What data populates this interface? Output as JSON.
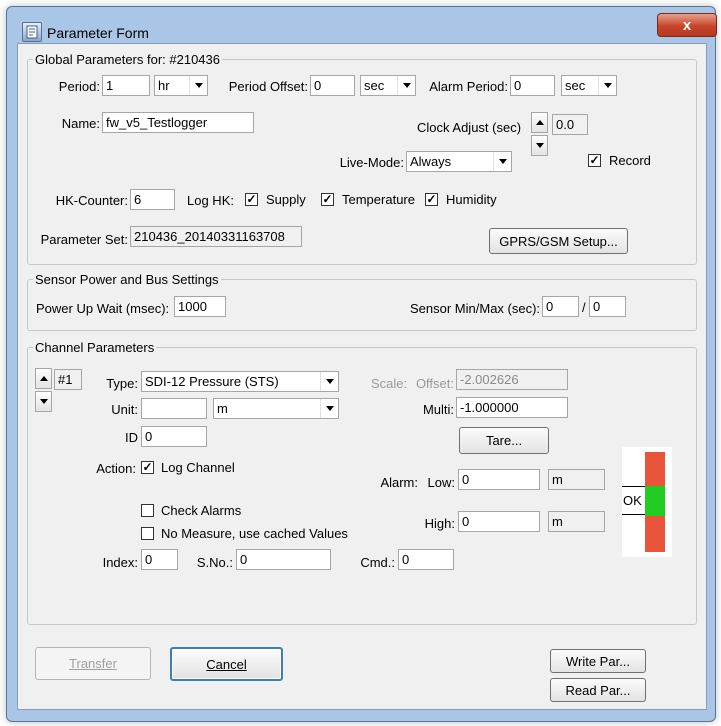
{
  "window": {
    "title": "Parameter Form",
    "close_label": "x"
  },
  "global": {
    "group_title": "Global Parameters for: #210436",
    "period": {
      "label": "Period:",
      "value": "1",
      "unit": "hr"
    },
    "period_offset": {
      "label": "Period Offset:",
      "value": "0",
      "unit": "sec"
    },
    "alarm_period": {
      "label": "Alarm Period:",
      "value": "0",
      "unit": "sec"
    },
    "name": {
      "label": "Name:",
      "value": "fw_v5_Testlogger"
    },
    "clock_adjust": {
      "label": "Clock Adjust (sec)",
      "value": "0.0"
    },
    "live_mode": {
      "label": "Live-Mode:",
      "value": "Always"
    },
    "record": {
      "label": "Record",
      "checked": true
    },
    "hk_counter": {
      "label": "HK-Counter:",
      "value": "6"
    },
    "log_hk": {
      "label": "Log HK:",
      "supply": {
        "label": "Supply",
        "checked": true
      },
      "temperature": {
        "label": "Temperature",
        "checked": true
      },
      "humidity": {
        "label": "Humidity",
        "checked": true
      }
    },
    "parameter_set": {
      "label": "Parameter Set:",
      "value": "210436_20140331163708"
    },
    "gprs_button": "GPRS/GSM Setup..."
  },
  "sensor_power": {
    "group_title": "Sensor Power and Bus Settings",
    "power_up_wait": {
      "label": "Power Up Wait  (msec):",
      "value": "1000"
    },
    "sensor_minmax": {
      "label": "Sensor Min/Max (sec):",
      "min": "0",
      "separator": "/",
      "max": "0"
    }
  },
  "channel": {
    "group_title": "Channel Parameters",
    "number": "#1",
    "type": {
      "label": "Type:",
      "value": "SDI-12 Pressure (STS)"
    },
    "scale": {
      "label": "Scale:"
    },
    "offset": {
      "label": "Offset:",
      "value": "-2.002626"
    },
    "unit": {
      "label": "Unit:",
      "custom": "",
      "value": "m"
    },
    "multi": {
      "label": "Multi:",
      "value": "-1.000000"
    },
    "id": {
      "label": "ID",
      "value": "0"
    },
    "tare_button": "Tare...",
    "action": {
      "label": "Action:",
      "log_channel": {
        "label": "Log Channel",
        "checked": true
      }
    },
    "alarm": {
      "label": "Alarm:",
      "low": {
        "label": "Low:",
        "value": "0",
        "unit": "m"
      },
      "high": {
        "label": "High:",
        "value": "0",
        "unit": "m"
      }
    },
    "check_alarms": {
      "label": "Check Alarms",
      "checked": false
    },
    "no_measure": {
      "label": "No Measure, use cached Values",
      "checked": false
    },
    "index": {
      "label": "Index:",
      "value": "0"
    },
    "sno": {
      "label": "S.No.:",
      "value": "0"
    },
    "cmd": {
      "label": "Cmd.:",
      "value": "0"
    },
    "status": {
      "label": "OK",
      "colors": {
        "alarm": "#e8553a",
        "ok": "#22cc22"
      }
    }
  },
  "buttons": {
    "transfer": "Transfer",
    "cancel": "Cancel",
    "write": "Write Par...",
    "read": "Read Par..."
  }
}
